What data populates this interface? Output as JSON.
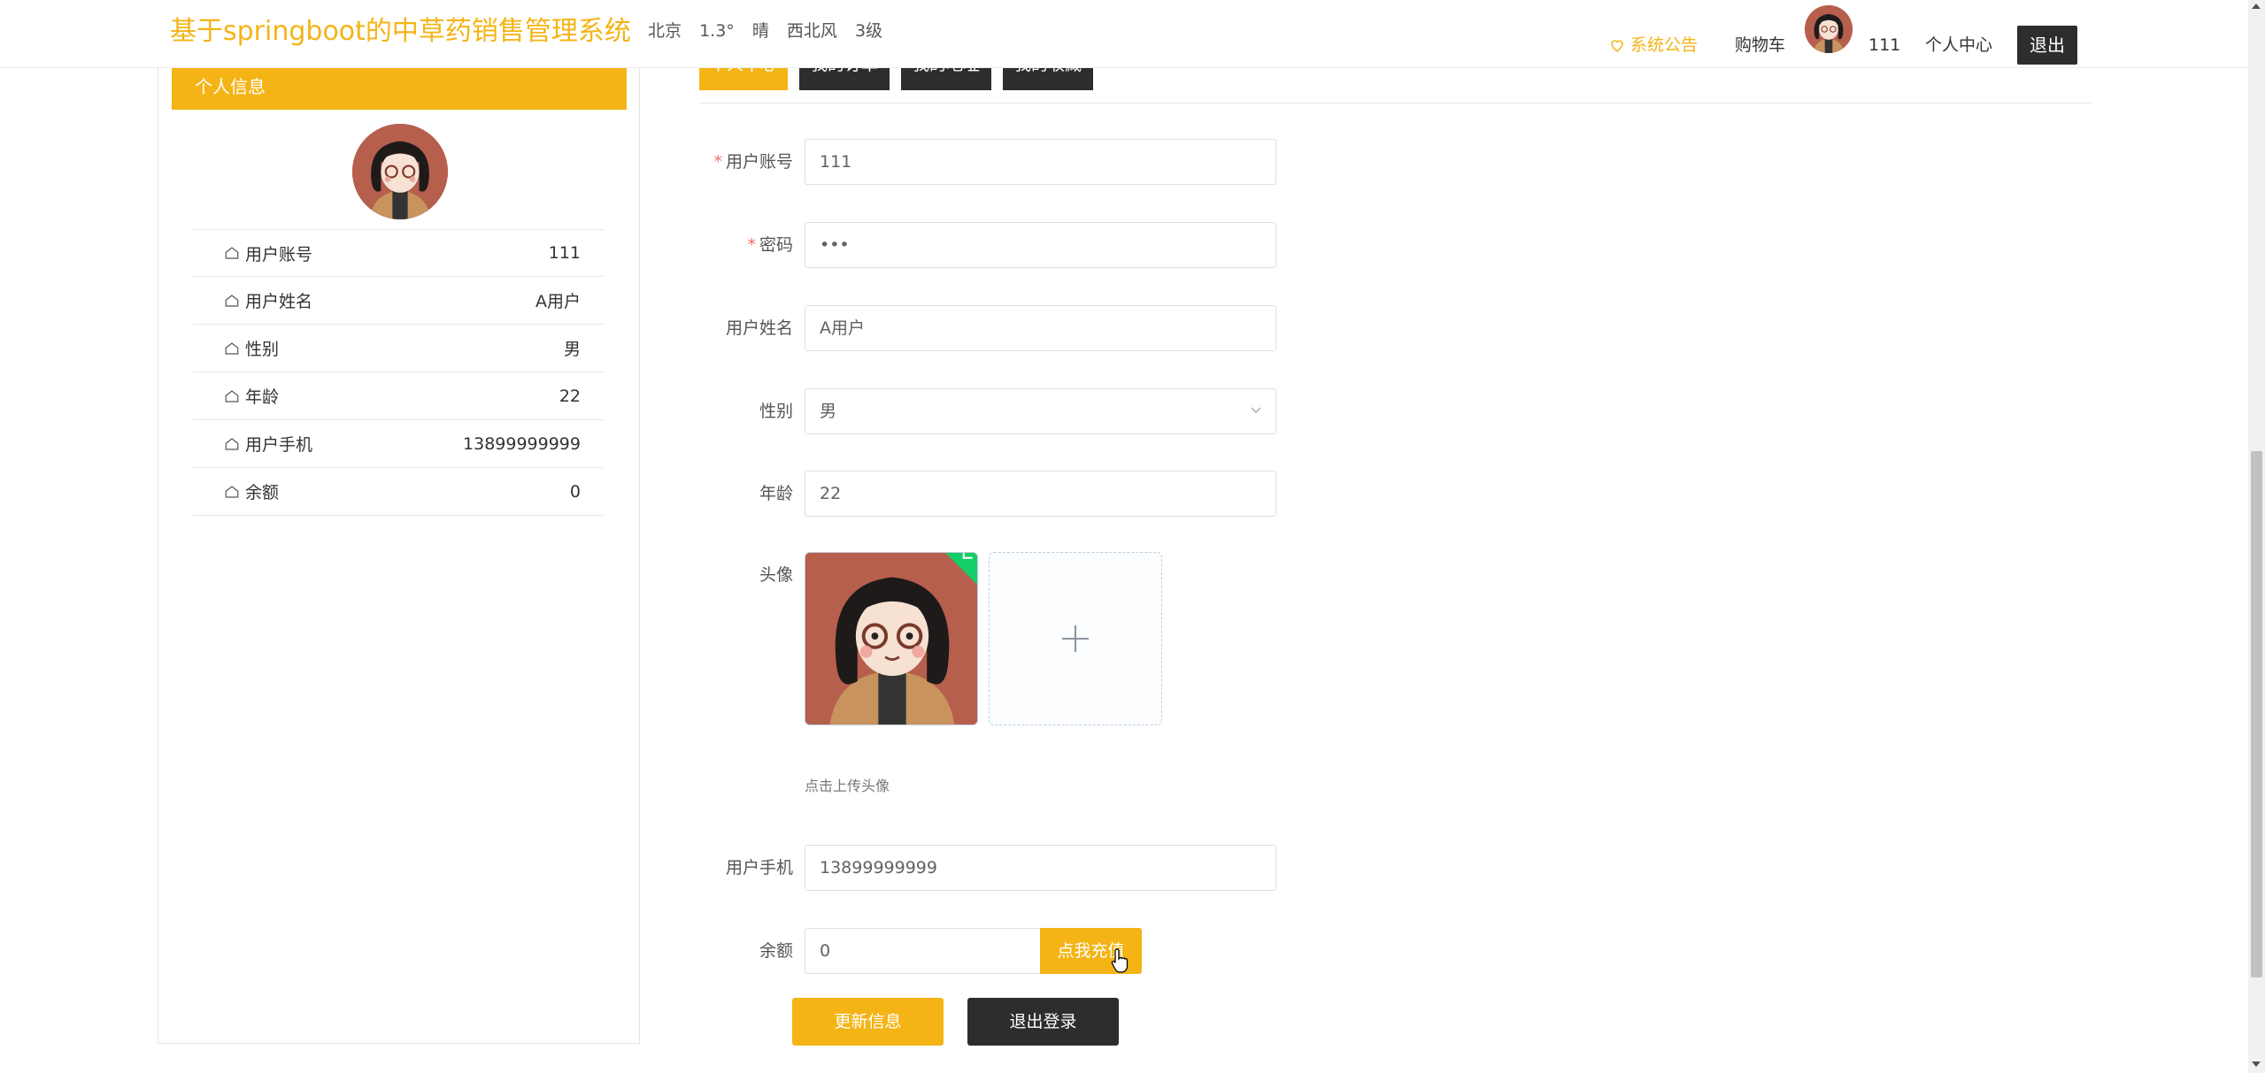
{
  "header": {
    "title": "基于springboot的中草药销售管理系统",
    "weather": {
      "city": "北京",
      "temp": "1.3°",
      "condition": "晴",
      "wind": "西北风",
      "level": "3级"
    },
    "notice": "系统公告",
    "cart": "购物车",
    "username": "111",
    "center": "个人中心",
    "logout": "退出"
  },
  "sidebar": {
    "title": "个人信息",
    "rows": [
      {
        "label": "用户账号",
        "value": "111"
      },
      {
        "label": "用户姓名",
        "value": "A用户"
      },
      {
        "label": "性别",
        "value": "男"
      },
      {
        "label": "年龄",
        "value": "22"
      },
      {
        "label": "用户手机",
        "value": "13899999999"
      },
      {
        "label": "余额",
        "value": "0"
      }
    ]
  },
  "tabs": [
    "个人中心",
    "我的订单",
    "我的地址",
    "我的收藏"
  ],
  "form": {
    "account": {
      "label": "用户账号",
      "value": "111"
    },
    "password": {
      "label": "密码",
      "value": "•••"
    },
    "name": {
      "label": "用户姓名",
      "value": "A用户"
    },
    "gender": {
      "label": "性别",
      "value": "男"
    },
    "age": {
      "label": "年龄",
      "value": "22"
    },
    "avatar": {
      "label": "头像",
      "hint": "点击上传头像"
    },
    "phone": {
      "label": "用户手机",
      "value": "13899999999"
    },
    "balance": {
      "label": "余额",
      "value": "0",
      "recharge": "点我充值"
    },
    "update": "更新信息",
    "logout": "退出登录"
  },
  "colors": {
    "accent": "#f4b416",
    "dark": "#2d2d2d",
    "success": "#13ce66"
  }
}
